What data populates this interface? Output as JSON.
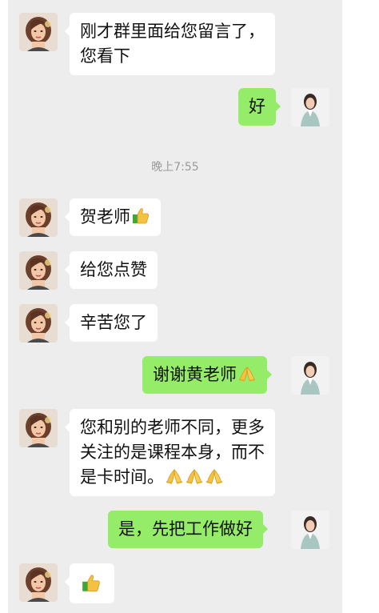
{
  "chat": {
    "timestamp": "晚上7:55",
    "messages": [
      {
        "side": "in",
        "lines": [
          "刚才群里面给您留言了，",
          "您看下"
        ]
      },
      {
        "side": "out",
        "text": "好"
      },
      {
        "side": "in",
        "text": "贺老师",
        "emoji": "thumbs-up-icon"
      },
      {
        "side": "in",
        "text": "给您点赞"
      },
      {
        "side": "in",
        "text": "辛苦您了"
      },
      {
        "side": "out",
        "text": "谢谢黄老师",
        "emoji": "pray-icon"
      },
      {
        "side": "in",
        "lines": [
          "您和别的老师不同，更多",
          "关注的是课程本身，而不",
          "是卡时间。"
        ],
        "emoji": "pray-icon x3"
      },
      {
        "side": "out",
        "text": "是，先把工作做好"
      },
      {
        "side": "in",
        "text": "",
        "emoji": "thumbs-up-icon"
      }
    ]
  },
  "colors": {
    "panel_background": "#ededed",
    "incoming_bubble": "#ffffff",
    "outgoing_bubble": "#95ec69",
    "timestamp_text": "#999999"
  }
}
